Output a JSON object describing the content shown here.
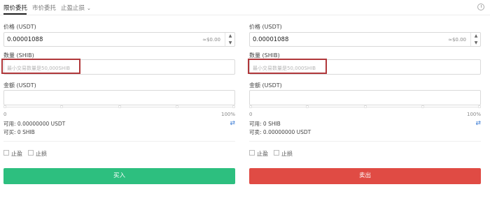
{
  "tabs": [
    {
      "label": "限价委托",
      "active": true
    },
    {
      "label": "市价委托",
      "active": false
    },
    {
      "label": "止盈止损",
      "active": false
    }
  ],
  "buy": {
    "price_label": "价格 (USDT)",
    "price_value": "0.00001088",
    "price_equiv": "≈$0.00",
    "qty_label": "数量 (SHIB)",
    "qty_placeholder": "最小交易数量是50,000SHIB",
    "amount_label": "金额 (USDT)",
    "slider_min": "0",
    "slider_max": "100%",
    "available": "可用: 0.00000000 USDT",
    "can_buy": "可买: 0 SHIB",
    "take_profit": "止盈",
    "stop_loss": "止损",
    "button_label": "买入",
    "button_color": "#2dbf7f"
  },
  "sell": {
    "price_label": "价格 (USDT)",
    "price_value": "0.00001088",
    "price_equiv": "≈$0.00",
    "qty_label": "数量 (SHIB)",
    "qty_placeholder": "最小交易数量是50,000SHIB",
    "amount_label": "金额 (USDT)",
    "slider_min": "0",
    "slider_max": "100%",
    "available": "可用: 0 SHIB",
    "can_sell": "可卖: 0.00000000 USDT",
    "take_profit": "止盈",
    "stop_loss": "止损",
    "button_label": "卖出",
    "button_color": "#e04b44"
  },
  "icons": {
    "swap": "⇄",
    "dropdown": "⌄",
    "step_up": "▲",
    "step_down": "▼"
  }
}
